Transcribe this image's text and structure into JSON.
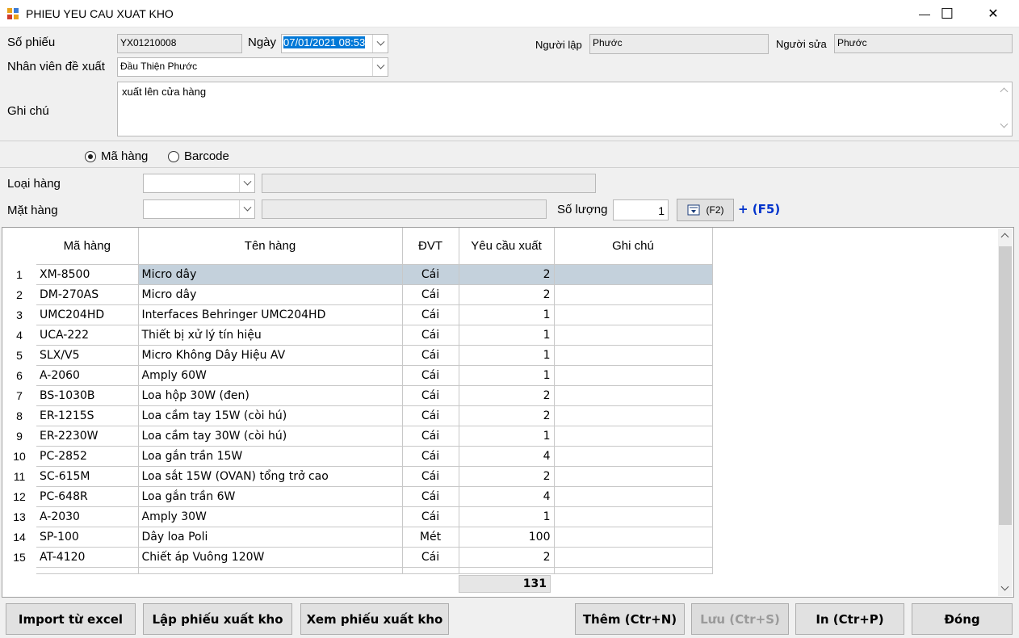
{
  "window": {
    "title": "PHIEU YEU CAU XUAT KHO",
    "minimize": "—",
    "maximize": "☐",
    "close": "✕"
  },
  "form": {
    "so_phieu_label": "Số phiếu",
    "so_phieu_value": "YX01210008",
    "ngay_label": "Ngày",
    "ngay_value": "07/01/2021 08:53",
    "nguoi_lap_label": "Người lập",
    "nguoi_lap_value": "Phước",
    "nguoi_sua_label": "Người sửa",
    "nguoi_sua_value": "Phước",
    "nhan_vien_label": "Nhân viên đề xuất",
    "nhan_vien_value": "Đầu Thiện Phước",
    "ghi_chu_label": "Ghi chú",
    "ghi_chu_value": "xuất lên cửa hàng"
  },
  "search_mode": {
    "ma_hang_label": "Mã hàng",
    "barcode_label": "Barcode",
    "selected": "Mã hàng"
  },
  "filter": {
    "loai_hang_label": "Loại hàng",
    "mat_hang_label": "Mặt hàng",
    "so_luong_label": "Số lượng",
    "so_luong_value": "1",
    "add_button_label": "(F2)",
    "f5_label": "+ (F5)"
  },
  "grid": {
    "columns": [
      "Mã hàng",
      "Tên hàng",
      "ĐVT",
      "Yêu cầu xuất",
      "Ghi chú"
    ],
    "rows": [
      {
        "n": "1",
        "code": "XM-8500",
        "name": "Micro dây",
        "unit": "Cái",
        "qty": "2",
        "note": ""
      },
      {
        "n": "2",
        "code": "DM-270AS",
        "name": "Micro dây",
        "unit": "Cái",
        "qty": "2",
        "note": ""
      },
      {
        "n": "3",
        "code": "UMC204HD",
        "name": "Interfaces Behringer UMC204HD",
        "unit": "Cái",
        "qty": "1",
        "note": ""
      },
      {
        "n": "4",
        "code": "UCA-222",
        "name": "Thiết bị xử lý tín hiệu",
        "unit": "Cái",
        "qty": "1",
        "note": ""
      },
      {
        "n": "5",
        "code": "SLX/V5",
        "name": "Micro Không Dây Hiệu AV",
        "unit": "Cái",
        "qty": "1",
        "note": ""
      },
      {
        "n": "6",
        "code": "A-2060",
        "name": "Amply 60W",
        "unit": "Cái",
        "qty": "1",
        "note": ""
      },
      {
        "n": "7",
        "code": "BS-1030B",
        "name": "Loa hộp 30W (đen)",
        "unit": "Cái",
        "qty": "2",
        "note": ""
      },
      {
        "n": "8",
        "code": "ER-1215S",
        "name": "Loa cầm tay 15W (còi hú)",
        "unit": "Cái",
        "qty": "2",
        "note": ""
      },
      {
        "n": "9",
        "code": "ER-2230W",
        "name": "Loa cầm tay 30W (còi hú)",
        "unit": "Cái",
        "qty": "1",
        "note": ""
      },
      {
        "n": "10",
        "code": "PC-2852",
        "name": "Loa gắn trần 15W",
        "unit": "Cái",
        "qty": "4",
        "note": ""
      },
      {
        "n": "11",
        "code": "SC-615M",
        "name": "Loa sắt 15W (OVAN) tổng trở cao",
        "unit": "Cái",
        "qty": "2",
        "note": ""
      },
      {
        "n": "12",
        "code": "PC-648R",
        "name": "Loa gắn trần 6W",
        "unit": "Cái",
        "qty": "4",
        "note": ""
      },
      {
        "n": "13",
        "code": "A-2030",
        "name": "Amply 30W",
        "unit": "Cái",
        "qty": "1",
        "note": ""
      },
      {
        "n": "14",
        "code": "SP-100",
        "name": "Dây loa Poli",
        "unit": "Mét",
        "qty": "100",
        "note": ""
      },
      {
        "n": "15",
        "code": "AT-4120",
        "name": "Chiết áp Vuông 120W",
        "unit": "Cái",
        "qty": "2",
        "note": ""
      }
    ],
    "total": "131"
  },
  "buttons": {
    "import_excel": "Import từ excel",
    "lap_phieu": "Lập phiếu xuất kho",
    "xem_phieu": "Xem phiếu xuất kho",
    "them": "Thêm (Ctr+N)",
    "luu": "Lưu (Ctr+S)",
    "in": "In (Ctr+P)",
    "dong": "Đóng"
  },
  "colors": {
    "selected_row": "#c4d1dc",
    "date_highlight": "#0078d7",
    "f5_color": "#0033cc"
  }
}
